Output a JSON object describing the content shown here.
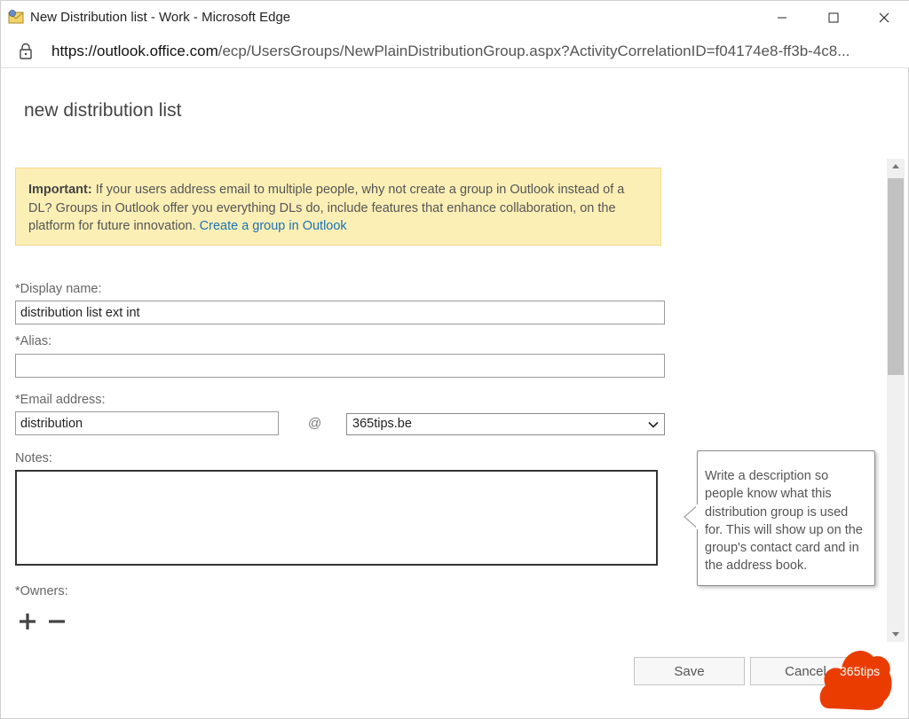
{
  "window": {
    "title": "New Distribution list - Work - Microsoft Edge",
    "url_host": "https://outlook.office.com",
    "url_path": "/ecp/UsersGroups/NewPlainDistributionGroup.aspx?ActivityCorrelationID=f04174e8-ff3b-4c8..."
  },
  "page": {
    "title": "new distribution list"
  },
  "notice": {
    "bold": "Important:",
    "text": " If your users address email to multiple people, why not create a group in Outlook instead of a DL? Groups in Outlook offer you everything DLs do, include features that enhance collaboration, on the platform for future innovation. ",
    "link": "Create a group in Outlook"
  },
  "form": {
    "display_name_label": "*Display name:",
    "display_name_value": "distribution list ext int",
    "alias_label": "*Alias:",
    "alias_value": "",
    "email_label": "*Email address:",
    "email_value": "distribution",
    "at_sign": "@",
    "domain_selected": "365tips.be",
    "notes_label": "Notes:",
    "owners_label": "*Owners:"
  },
  "tooltip": {
    "text": "Write a description so people know what this distribution group is used for. This will show up on the group's contact card and in the address book."
  },
  "buttons": {
    "save": "Save",
    "cancel": "Cancel"
  },
  "badge": {
    "text": "365tips",
    "color": "#eb3c00"
  },
  "colors": {
    "notice_bg": "#fcefb6",
    "link": "#1a73b8"
  }
}
